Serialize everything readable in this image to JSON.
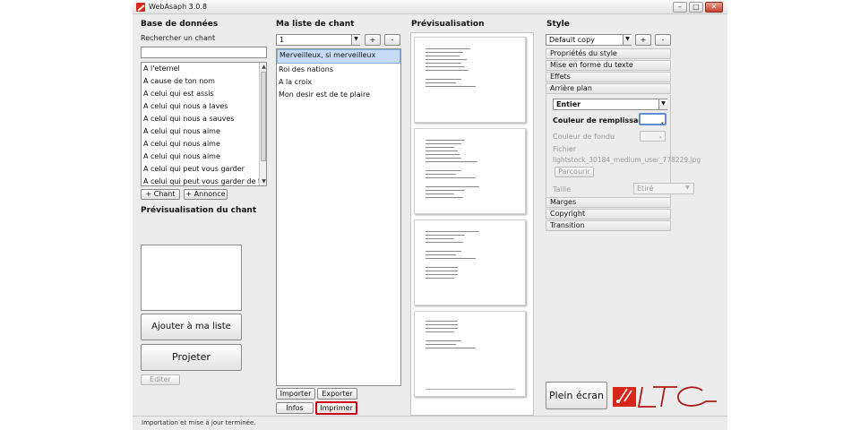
{
  "window": {
    "title": "WebAsaph 3.0.8",
    "controls": {
      "minimize": "–",
      "maximize": "□",
      "close": "✕"
    }
  },
  "left": {
    "header": "Base de données",
    "search_label": "Rechercher un chant",
    "search_value": "",
    "songs": [
      "A l'eternel",
      "A cause de ton nom",
      "A celui qui est assis",
      "A celui qui nous a laves",
      "A celui qui nous a sauves",
      "A celui qui nous aime",
      "A celui qui nous aime",
      "A celui qui nous aime",
      "A celui qui peut vous garder",
      "A celui qui peut vous garder de tombe"
    ],
    "add_song": "+ Chant",
    "add_announce": "+ Annonce",
    "preview_header": "Prévisualisation du chant",
    "add_to_list": "Ajouter à ma liste",
    "project": "Projeter",
    "edit": "Editer"
  },
  "middle": {
    "header": "Ma liste de chant",
    "list_selector": "1",
    "plus": "+",
    "minus": "-",
    "items": [
      "Merveilleux, si merveilleux",
      "Roi des nations",
      "A la croix",
      "Mon desir est de te plaire"
    ],
    "selected_index": 0,
    "import": "Importer",
    "export": "Exporter",
    "infos": "Infos",
    "print": "Imprimer"
  },
  "preview": {
    "header": "Prévisualisation"
  },
  "style": {
    "header": "Style",
    "preset": "Default copy",
    "plus": "+",
    "minus": "-",
    "sections": [
      "Propriétés du style",
      "Mise en forme du texte",
      "Effets",
      "Arrière plan"
    ],
    "bg_mode": "Entier",
    "fill_color_label": "Couleur de remplissage",
    "fade_color_label": "Couleur de fondu",
    "file_label": "Fichier",
    "file_name": "lightstock_30184_medium_user_778229.jpg",
    "browse": "Parcourir",
    "size_label": "Taille",
    "size_value": "Etiré",
    "sections_after": [
      "Marges",
      "Copyright",
      "Transition"
    ],
    "fullscreen": "Plein écran",
    "logo_text": "LTC"
  },
  "status": "Importation et mise à jour terminée.",
  "colors": {
    "accent": "#d9261c",
    "selection": "#c7dcf4",
    "print_highlight": "#d0001a"
  }
}
